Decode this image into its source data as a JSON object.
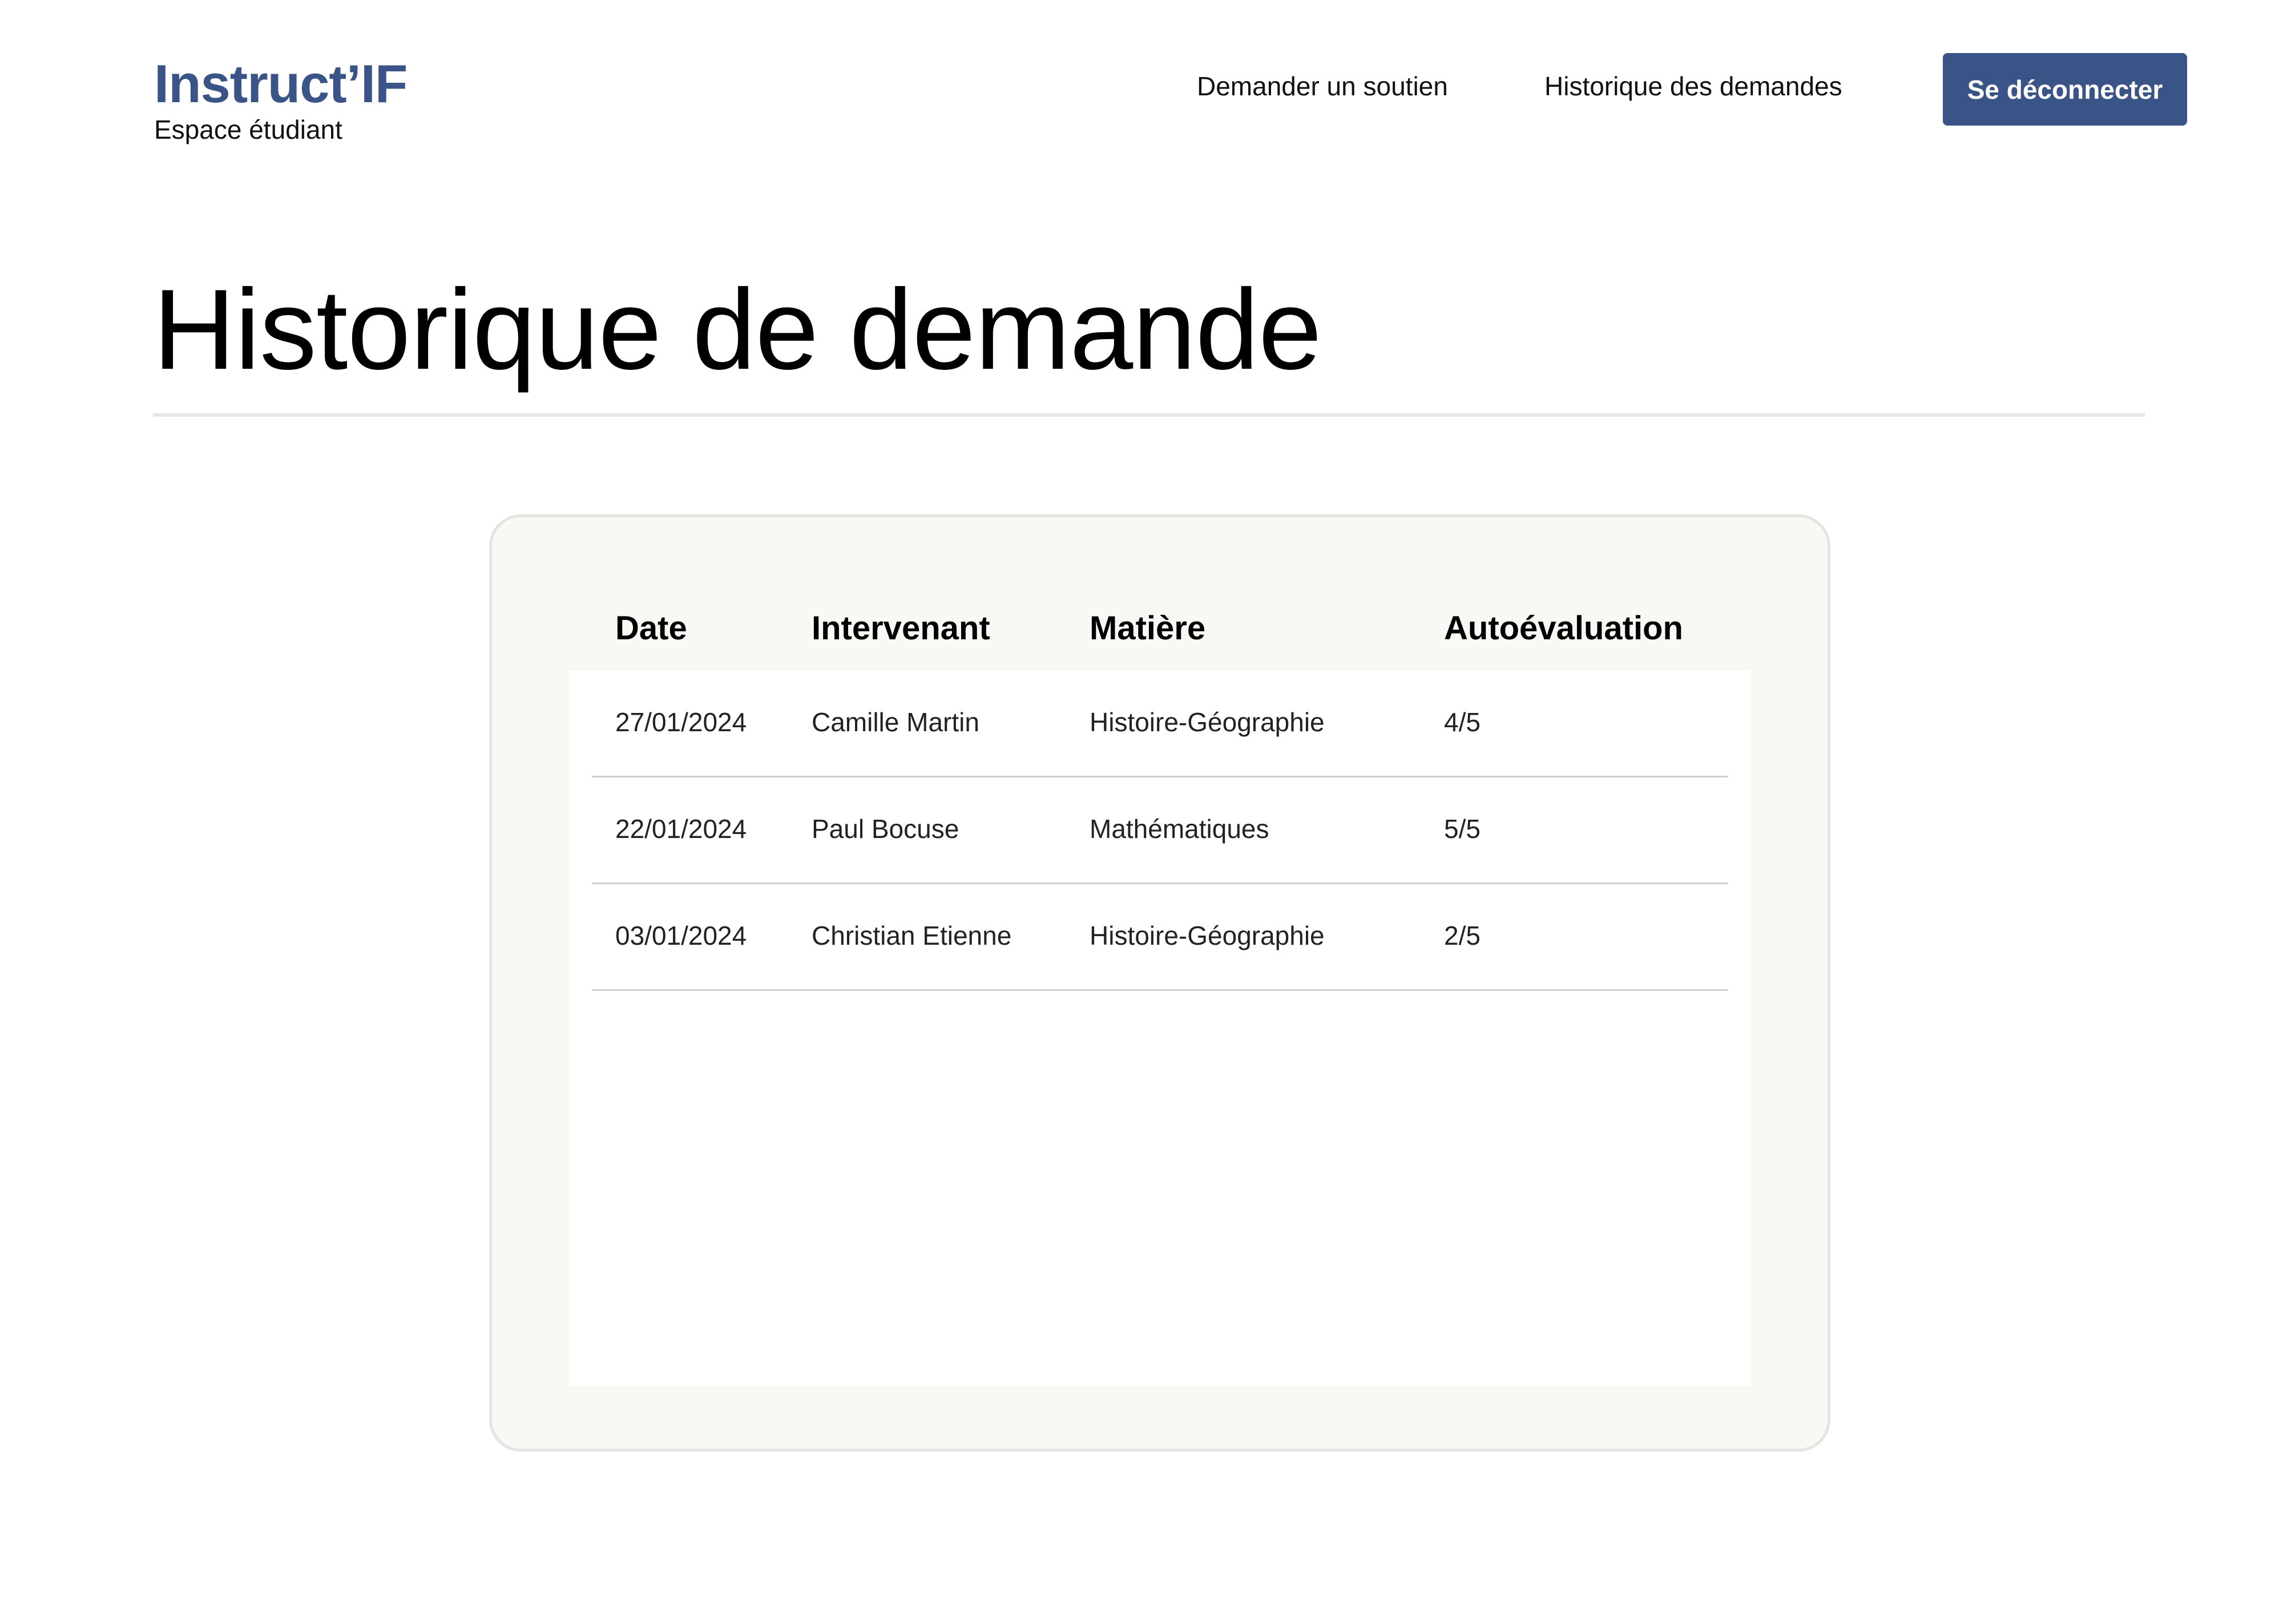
{
  "header": {
    "brand_name": "Instruct’IF",
    "brand_subtitle": "Espace étudiant",
    "nav": [
      {
        "label": "Demander un soutien"
      },
      {
        "label": "Historique des demandes"
      }
    ],
    "logout_label": "Se déconnecter"
  },
  "main": {
    "title": "Historique de demande",
    "table": {
      "columns": [
        "Date",
        "Intervenant",
        "Matière",
        "Autoévaluation"
      ],
      "rows": [
        {
          "date": "27/01/2024",
          "intervenant": "Camille Martin",
          "matiere": "Histoire-Géographie",
          "autoevaluation": "4/5"
        },
        {
          "date": "22/01/2024",
          "intervenant": "Paul Bocuse",
          "matiere": "Mathématiques",
          "autoevaluation": "5/5"
        },
        {
          "date": "03/01/2024",
          "intervenant": "Christian Etienne",
          "matiere": "Histoire-Géographie",
          "autoevaluation": "2/5"
        }
      ]
    }
  },
  "colors": {
    "brand": "#3a5488",
    "card_background": "#f8f8f4",
    "divider": "#cfcfcf"
  }
}
